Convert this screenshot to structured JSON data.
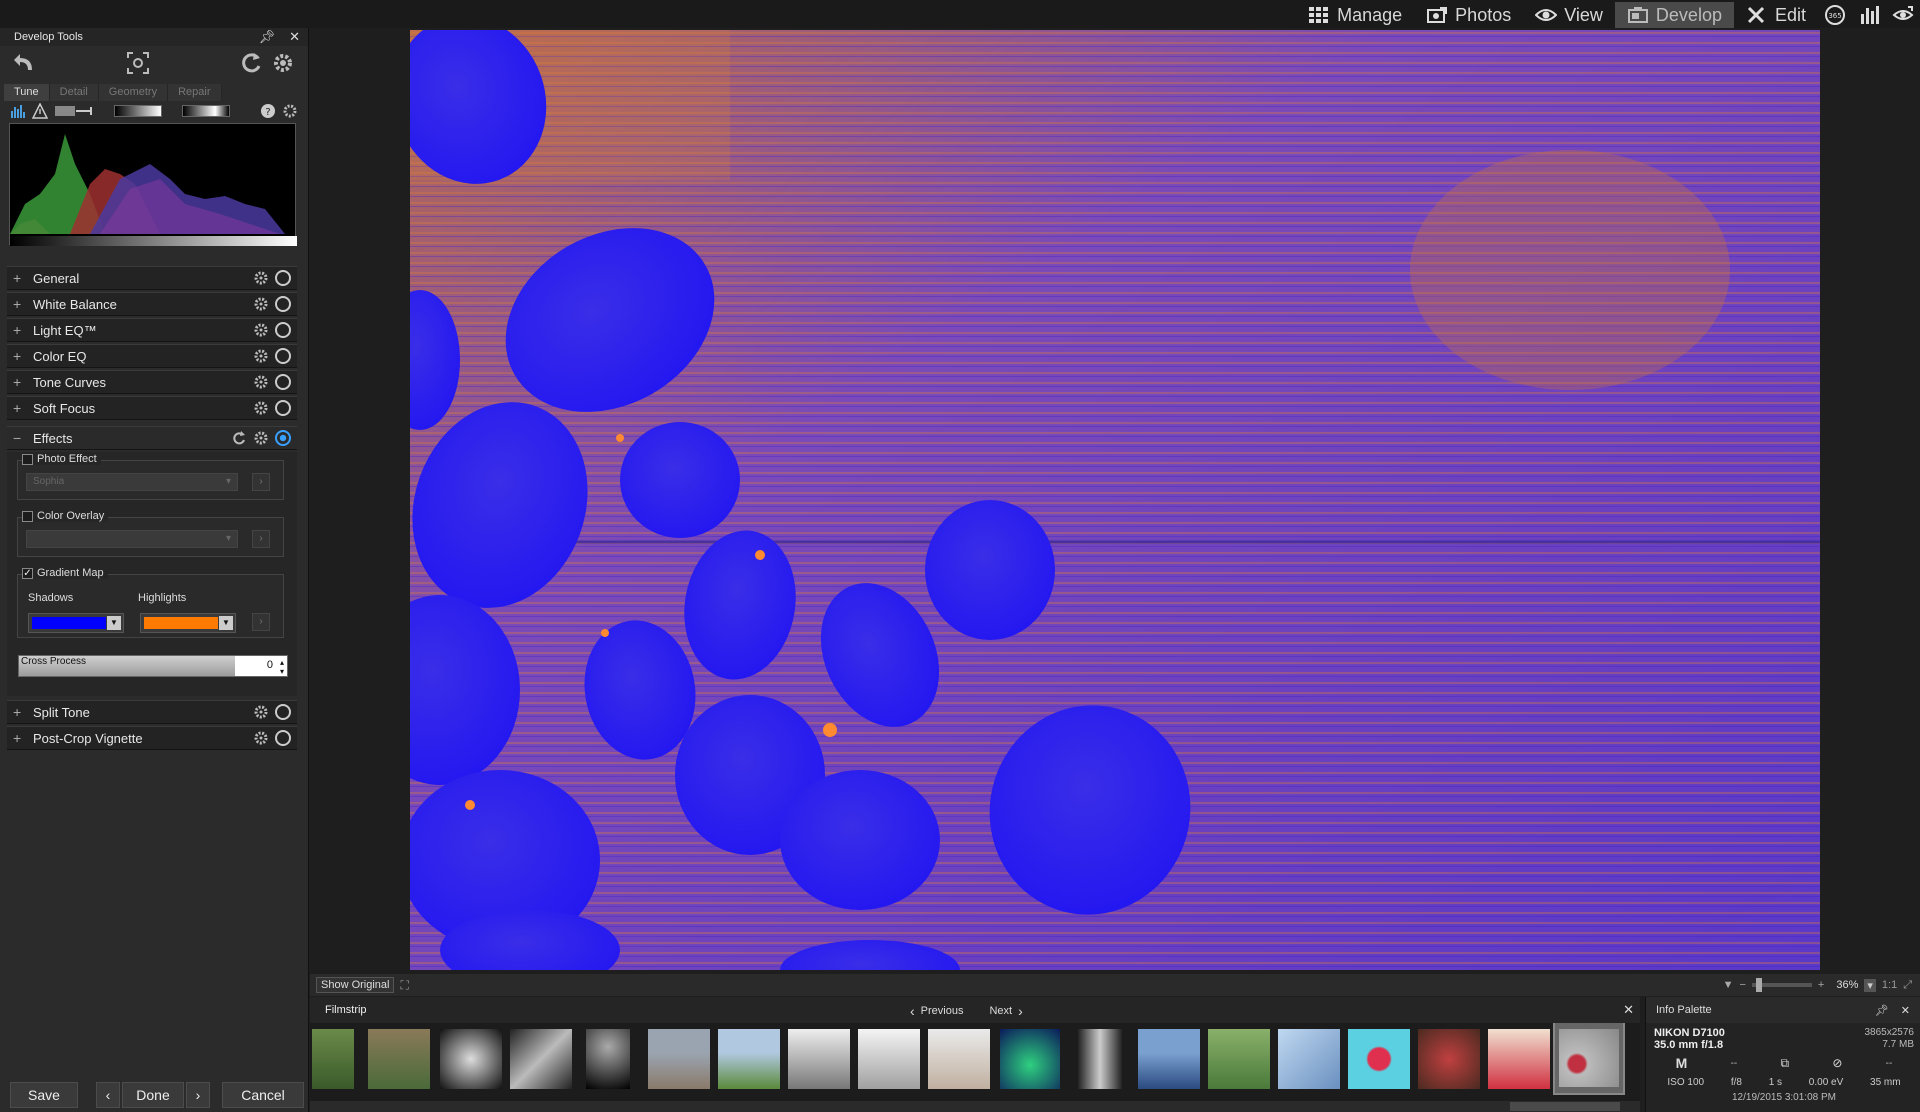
{
  "topnav": {
    "manage": "Manage",
    "photos": "Photos",
    "view": "View",
    "develop": "Develop",
    "edit": "Edit"
  },
  "develop_tools": {
    "title": "Develop Tools",
    "tabs": [
      "Tune",
      "Detail",
      "Geometry",
      "Repair"
    ],
    "sections_top": [
      "General",
      "White Balance",
      "Light EQ™",
      "Color EQ",
      "Tone Curves",
      "Soft Focus",
      "Effects"
    ],
    "sections_bottom": [
      "Split Tone",
      "Post-Crop Vignette"
    ],
    "effects": {
      "photo_effect_label": "Photo Effect",
      "photo_effect_value": "Sophia",
      "color_overlay_label": "Color Overlay",
      "gradient_map_label": "Gradient Map",
      "shadows_label": "Shadows",
      "highlights_label": "Highlights",
      "shadows_color": "#0000ff",
      "highlights_color": "#ff7a00",
      "cross_process_label": "Cross Process",
      "cross_process_value": "0"
    },
    "buttons": {
      "save": "Save",
      "done": "Done",
      "cancel": "Cancel"
    }
  },
  "viewer": {
    "show_original": "Show Original",
    "zoom": "36%",
    "one_to_one": "1:1"
  },
  "filmstrip": {
    "title": "Filmstrip",
    "previous": "Previous",
    "next": "Next"
  },
  "info_palette": {
    "title": "Info Palette",
    "camera": "NIKON D7100",
    "lens": "35.0 mm f/1.8",
    "dimensions": "3865x2576",
    "filesize": "7.7 MB",
    "mode": "M",
    "exposure_row": [
      "--",
      "--",
      "--"
    ],
    "iso": "ISO 100",
    "aperture": "f/8",
    "shutter": "1 s",
    "ev": "0.00 eV",
    "focal": "35 mm",
    "datetime": "12/19/2015 3:01:08 PM"
  },
  "colors": {
    "accent": "#3aa0ff",
    "image_orange": "#e07a3a",
    "image_purple": "#5a3ad0",
    "image_blue": "#2a1ef0"
  }
}
